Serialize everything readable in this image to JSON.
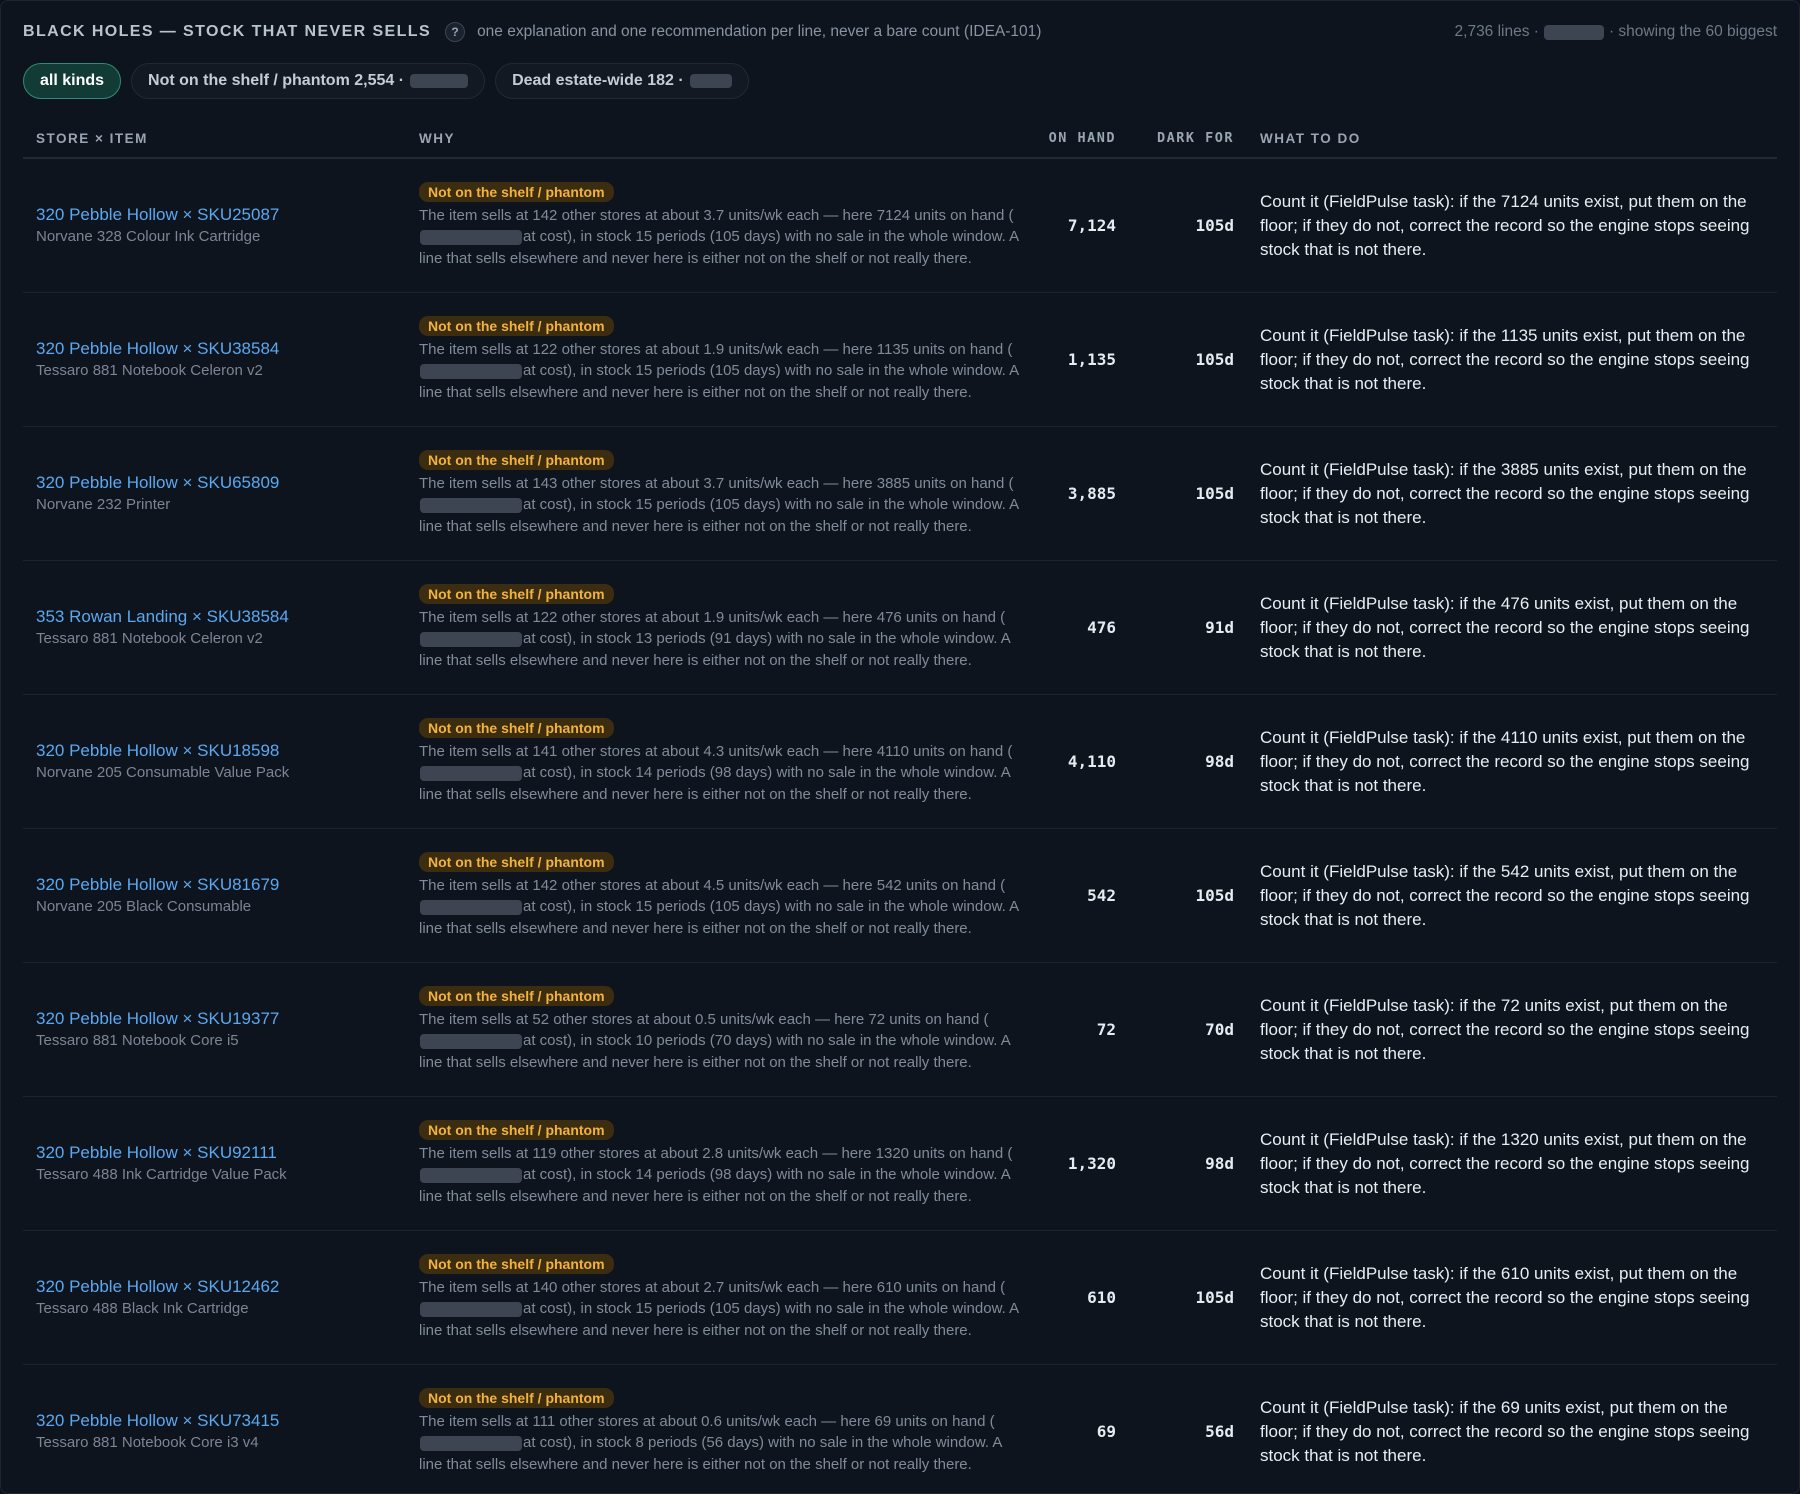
{
  "header": {
    "title": "BLACK HOLES — STOCK THAT NEVER SELLS",
    "help_icon": "?",
    "subtitle": "one explanation and one recommendation per line, never a bare count (IDEA-101)",
    "lines": "2,736 lines ·",
    "showing": "· showing the 60 biggest"
  },
  "chips": [
    {
      "label": "all kinds",
      "active": true
    },
    {
      "label": "Not on the shelf / phantom 2,554 ·",
      "active": false
    },
    {
      "label": "Dead estate-wide 182 ·",
      "active": false
    }
  ],
  "columns": {
    "store_item": "STORE × ITEM",
    "why": "WHY",
    "on_hand": "ON HAND",
    "dark_for": "DARK FOR",
    "what_to_do": "WHAT TO DO"
  },
  "rows": [
    {
      "store": "320 Pebble Hollow × SKU25087",
      "product": "Norvane 328 Colour Ink Cartridge",
      "badge": "Not on the shelf / phantom",
      "why_a": "The item sells at 142 other stores at about 3.7 units/wk each — here 7124 units on hand (",
      "why_b": "at cost), in stock 15 periods (105 days) with no sale in the whole window. A line that sells elsewhere and never here is either not on the shelf or not really there.",
      "on_hand": "7,124",
      "dark_for": "105d",
      "todo": "Count it (FieldPulse task): if the 7124 units exist, put them on the floor; if they do not, correct the record so the engine stops seeing stock that is not there."
    },
    {
      "store": "320 Pebble Hollow × SKU38584",
      "product": "Tessaro 881 Notebook Celeron v2",
      "badge": "Not on the shelf / phantom",
      "why_a": "The item sells at 122 other stores at about 1.9 units/wk each — here 1135 units on hand (",
      "why_b": "at cost), in stock 15 periods (105 days) with no sale in the whole window. A line that sells elsewhere and never here is either not on the shelf or not really there.",
      "on_hand": "1,135",
      "dark_for": "105d",
      "todo": "Count it (FieldPulse task): if the 1135 units exist, put them on the floor; if they do not, correct the record so the engine stops seeing stock that is not there."
    },
    {
      "store": "320 Pebble Hollow × SKU65809",
      "product": "Norvane 232 Printer",
      "badge": "Not on the shelf / phantom",
      "why_a": "The item sells at 143 other stores at about 3.7 units/wk each — here 3885 units on hand (",
      "why_b": "at cost), in stock 15 periods (105 days) with no sale in the whole window. A line that sells elsewhere and never here is either not on the shelf or not really there.",
      "on_hand": "3,885",
      "dark_for": "105d",
      "todo": "Count it (FieldPulse task): if the 3885 units exist, put them on the floor; if they do not, correct the record so the engine stops seeing stock that is not there."
    },
    {
      "store": "353 Rowan Landing × SKU38584",
      "product": "Tessaro 881 Notebook Celeron v2",
      "badge": "Not on the shelf / phantom",
      "why_a": "The item sells at 122 other stores at about 1.9 units/wk each — here 476 units on hand (",
      "why_b": "at cost), in stock 13 periods (91 days) with no sale in the whole window. A line that sells elsewhere and never here is either not on the shelf or not really there.",
      "on_hand": "476",
      "dark_for": "91d",
      "todo": "Count it (FieldPulse task): if the 476 units exist, put them on the floor; if they do not, correct the record so the engine stops seeing stock that is not there."
    },
    {
      "store": "320 Pebble Hollow × SKU18598",
      "product": "Norvane 205 Consumable Value Pack",
      "badge": "Not on the shelf / phantom",
      "why_a": "The item sells at 141 other stores at about 4.3 units/wk each — here 4110 units on hand (",
      "why_b": "at cost), in stock 14 periods (98 days) with no sale in the whole window. A line that sells elsewhere and never here is either not on the shelf or not really there.",
      "on_hand": "4,110",
      "dark_for": "98d",
      "todo": "Count it (FieldPulse task): if the 4110 units exist, put them on the floor; if they do not, correct the record so the engine stops seeing stock that is not there."
    },
    {
      "store": "320 Pebble Hollow × SKU81679",
      "product": "Norvane 205 Black Consumable",
      "badge": "Not on the shelf / phantom",
      "why_a": "The item sells at 142 other stores at about 4.5 units/wk each — here 542 units on hand (",
      "why_b": "at cost), in stock 15 periods (105 days) with no sale in the whole window. A line that sells elsewhere and never here is either not on the shelf or not really there.",
      "on_hand": "542",
      "dark_for": "105d",
      "todo": "Count it (FieldPulse task): if the 542 units exist, put them on the floor; if they do not, correct the record so the engine stops seeing stock that is not there."
    },
    {
      "store": "320 Pebble Hollow × SKU19377",
      "product": "Tessaro 881 Notebook Core i5",
      "badge": "Not on the shelf / phantom",
      "why_a": "The item sells at 52 other stores at about 0.5 units/wk each — here 72 units on hand (",
      "why_b": "at cost), in stock 10 periods (70 days) with no sale in the whole window. A line that sells elsewhere and never here is either not on the shelf or not really there.",
      "on_hand": "72",
      "dark_for": "70d",
      "todo": "Count it (FieldPulse task): if the 72 units exist, put them on the floor; if they do not, correct the record so the engine stops seeing stock that is not there."
    },
    {
      "store": "320 Pebble Hollow × SKU92111",
      "product": "Tessaro 488 Ink Cartridge Value Pack",
      "badge": "Not on the shelf / phantom",
      "why_a": "The item sells at 119 other stores at about 2.8 units/wk each — here 1320 units on hand (",
      "why_b": "at cost), in stock 14 periods (98 days) with no sale in the whole window. A line that sells elsewhere and never here is either not on the shelf or not really there.",
      "on_hand": "1,320",
      "dark_for": "98d",
      "todo": "Count it (FieldPulse task): if the 1320 units exist, put them on the floor; if they do not, correct the record so the engine stops seeing stock that is not there."
    },
    {
      "store": "320 Pebble Hollow × SKU12462",
      "product": "Tessaro 488 Black Ink Cartridge",
      "badge": "Not on the shelf / phantom",
      "why_a": "The item sells at 140 other stores at about 2.7 units/wk each — here 610 units on hand (",
      "why_b": "at cost), in stock 15 periods (105 days) with no sale in the whole window. A line that sells elsewhere and never here is either not on the shelf or not really there.",
      "on_hand": "610",
      "dark_for": "105d",
      "todo": "Count it (FieldPulse task): if the 610 units exist, put them on the floor; if they do not, correct the record so the engine stops seeing stock that is not there."
    },
    {
      "store": "320 Pebble Hollow × SKU73415",
      "product": "Tessaro 881 Notebook Core i3 v4",
      "badge": "Not on the shelf / phantom",
      "why_a": "The item sells at 111 other stores at about 0.6 units/wk each — here 69 units on hand (",
      "why_b": "at cost), in stock 8 periods (56 days) with no sale in the whole window. A line that sells elsewhere and never here is either not on the shelf or not really there.",
      "on_hand": "69",
      "dark_for": "56d",
      "todo": "Count it (FieldPulse task): if the 69 units exist, put them on the floor; if they do not, correct the record so the engine stops seeing stock that is not there."
    }
  ]
}
